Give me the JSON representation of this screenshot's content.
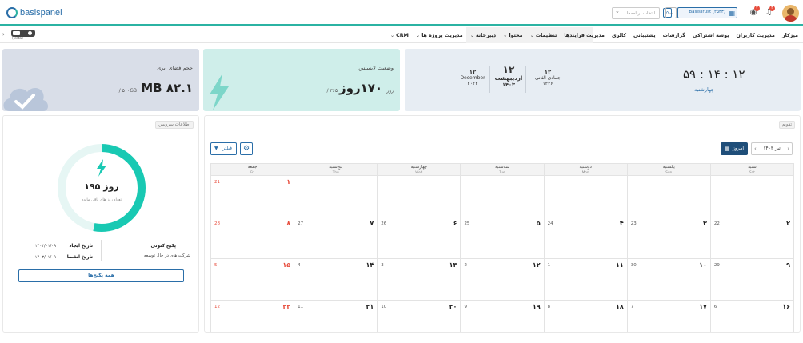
{
  "header": {
    "logo_text": "basispanel",
    "search_placeholder": "انتخاب برنامه‌ها",
    "company": "BasisTrust (۲۵۴۳)",
    "badges": {
      "notifications": "۳",
      "messages": "۲"
    },
    "icons": [
      "bell-icon",
      "eye-icon",
      "store-icon",
      "chevron-down-icon"
    ]
  },
  "nav": {
    "items": [
      {
        "label": "میزکار",
        "drop": false
      },
      {
        "label": "مدیریت کاربران",
        "drop": false
      },
      {
        "label": "پوشه اشتراکی",
        "drop": false
      },
      {
        "label": "گزارشات",
        "drop": false
      },
      {
        "label": "پشتیبانی",
        "drop": false
      },
      {
        "label": "کالری",
        "drop": false
      },
      {
        "label": "مدیریت فرایندها",
        "drop": false
      },
      {
        "label": "تنظیمات",
        "drop": true
      },
      {
        "label": "محتوا",
        "drop": true
      },
      {
        "label": "دبیرخانه",
        "drop": true
      },
      {
        "label": "مدیریت پروژه ها",
        "drop": true
      },
      {
        "label": "CRM",
        "drop": true
      }
    ],
    "beta_label": "(Beta)"
  },
  "storage_card": {
    "title": "حجم فضای ابری",
    "used": "MB ۸۲.۱",
    "total": "/ ۵۰۰GB"
  },
  "license_card": {
    "title": "وضعیت لایسنس",
    "remaining": "۱۷۰روز",
    "total": "/ ۳۶۵ روز"
  },
  "date_card": {
    "clock": "۵۹ : ۱۴ : ۱۲",
    "weekday": "چهارشنبه",
    "hijri": {
      "day": "۱۲",
      "month": "جمادی الثانی",
      "year": "۱۴۴۶"
    },
    "jalali": {
      "day": "۱۲",
      "month": "اردیبهشت",
      "year": "۱۴۰۳"
    },
    "gregorian": {
      "day": "۱۲",
      "month": "December",
      "year": "۲۰۲۴"
    }
  },
  "service": {
    "tag": "اطلاعات سرویس",
    "days_left": "۱۹۵ روز",
    "days_sub": "تعداد روز های باقی مانده",
    "progress_fraction": 0.53,
    "package_label": "پکیج کنونی",
    "package_value": "شرکت های در حال توسعه",
    "created_label": "تاریخ ایجاد",
    "created_value": "۱۴۰۳/۰۱/۰۹",
    "expire_label": "تاریخ انقضا",
    "expire_value": "۱۴۰۳/۰۱/۰۹",
    "all_packages": "همه پکیج‌ها"
  },
  "calendar": {
    "tag": "تقویم",
    "month_label": "تیر ۱۴۰۳",
    "today": "امروز",
    "filter": "فیلتر",
    "dow": [
      {
        "fa": "شنبه",
        "en": "Sat"
      },
      {
        "fa": "یکشنبه",
        "en": "Sun"
      },
      {
        "fa": "دوشنبه",
        "en": "Mon"
      },
      {
        "fa": "سه‌شنبه",
        "en": "Tue"
      },
      {
        "fa": "چهارشنبه",
        "en": "Wed"
      },
      {
        "fa": "پنج‌شنبه",
        "en": "Thu"
      },
      {
        "fa": "جمعه",
        "en": "Fri"
      }
    ],
    "weeks": [
      [
        null,
        null,
        null,
        null,
        null,
        null,
        {
          "pd": "۱",
          "gd": "21"
        }
      ],
      [
        {
          "pd": "۲",
          "gd": "22"
        },
        {
          "pd": "۳",
          "gd": "23"
        },
        {
          "pd": "۴",
          "gd": "24"
        },
        {
          "pd": "۵",
          "gd": "25"
        },
        {
          "pd": "۶",
          "gd": "26"
        },
        {
          "pd": "۷",
          "gd": "27"
        },
        {
          "pd": "۸",
          "gd": "28"
        }
      ],
      [
        {
          "pd": "۹",
          "gd": "29"
        },
        {
          "pd": "۱۰",
          "gd": "30"
        },
        {
          "pd": "۱۱",
          "gd": "1"
        },
        {
          "pd": "۱۲",
          "gd": "2"
        },
        {
          "pd": "۱۳",
          "gd": "3"
        },
        {
          "pd": "۱۴",
          "gd": "4"
        },
        {
          "pd": "۱۵",
          "gd": "5"
        }
      ],
      [
        {
          "pd": "۱۶",
          "gd": "6"
        },
        {
          "pd": "۱۷",
          "gd": "7"
        },
        {
          "pd": "۱۸",
          "gd": "8"
        },
        {
          "pd": "۱۹",
          "gd": "9"
        },
        {
          "pd": "۲۰",
          "gd": "10"
        },
        {
          "pd": "۲۱",
          "gd": "11"
        },
        {
          "pd": "۲۲",
          "gd": "12"
        }
      ]
    ]
  },
  "colors": {
    "accent": "#2bb3a3",
    "primary": "#2a6ea8",
    "navy": "#1f4e79",
    "friday": "#e74c3c"
  }
}
